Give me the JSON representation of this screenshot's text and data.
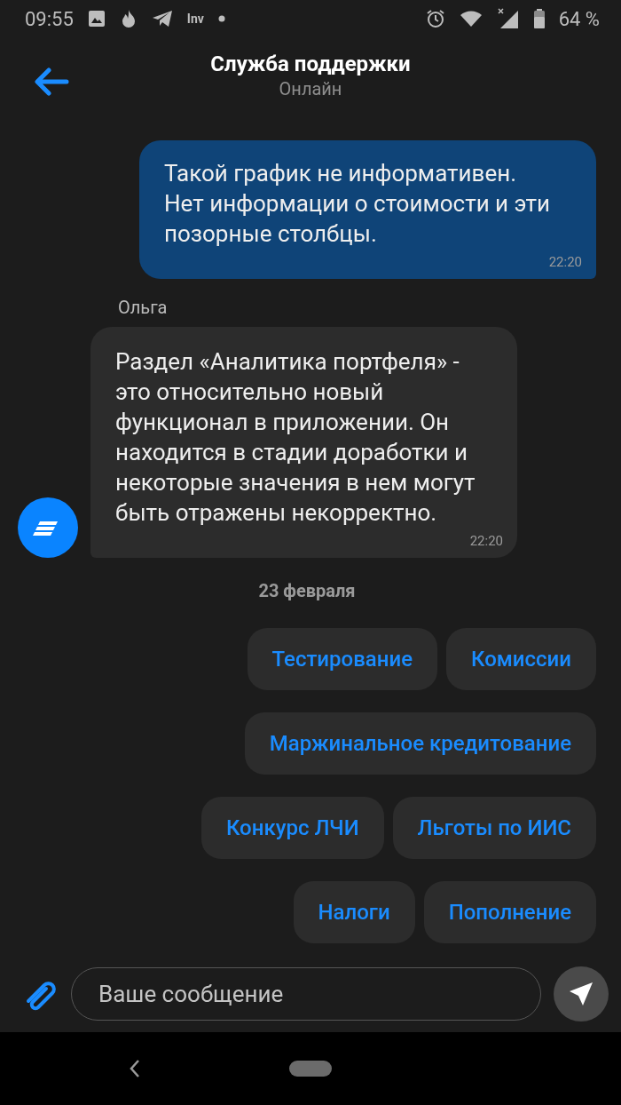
{
  "status_bar": {
    "time": "09:55",
    "app_label": "Inv",
    "battery": "64 %"
  },
  "header": {
    "title": "Служба поддержки",
    "subtitle": "Онлайн"
  },
  "messages": [
    {
      "kind": "outgoing",
      "text": "Такой график не информативен. Нет информации о стоимости и эти позорные столбцы.",
      "time": "22:20"
    },
    {
      "kind": "incoming",
      "sender": "Ольга",
      "text": "Раздел «Аналитика портфеля» - это относительно новый функционал в приложении. Он находится в стадии доработки и некоторые значения в нем могут быть отражены некорректно.",
      "time": "22:20"
    }
  ],
  "date_separator": "23 февраля",
  "quick_replies": [
    [
      "Тестирование",
      "Комиссии"
    ],
    [
      "Маржинальное кредитование"
    ],
    [
      "Конкурс ЛЧИ",
      "Льготы по ИИС"
    ],
    [
      "Налоги",
      "Пополнение"
    ]
  ],
  "composer": {
    "placeholder": "Ваше сообщение"
  }
}
